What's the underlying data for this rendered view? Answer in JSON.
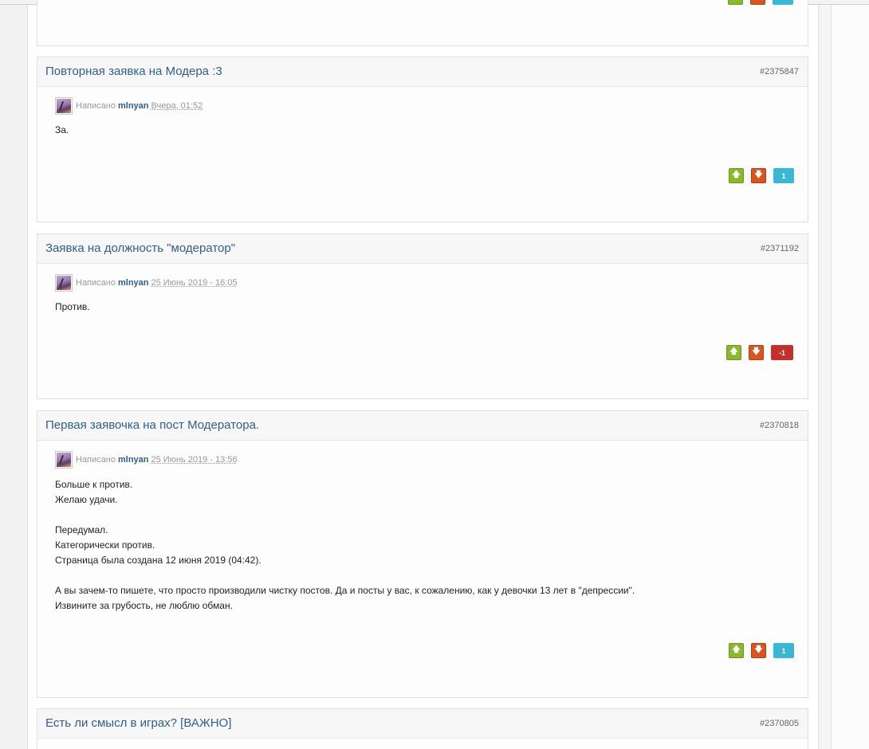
{
  "posts": [
    {
      "title": "Повторная заявка на Модера :3",
      "number": "#2375847",
      "written_label": "Написано",
      "author": "mlnyan",
      "date": "Вчера, 01:52",
      "lines": [
        "За."
      ],
      "reputation": "1",
      "rep_sign": "positive"
    },
    {
      "title": "Заявка на должность \"модератор\"",
      "number": "#2371192",
      "written_label": "Написано",
      "author": "mlnyan",
      "date": "25 Июнь 2019 - 16:05",
      "lines": [
        "Против."
      ],
      "reputation": "-1",
      "rep_sign": "negative"
    },
    {
      "title": "Первая заявочка на пост Модератора.",
      "number": "#2370818",
      "written_label": "Написано",
      "author": "mlnyan",
      "date": "25 Июнь 2019 - 13:56",
      "lines": [
        "Больше к против.",
        "Желаю удачи.",
        "",
        "Передумал.",
        "Категорически против.",
        "Страница была создана 12 июня 2019 (04:42).",
        "",
        "А вы зачем-то пишете, что просто производили чистку постов. Да и посты у вас, к сожалению, как у девочки 13 лет в \"депрессии\".",
        "Извините за грубость, не люблю обман."
      ],
      "reputation": "1",
      "rep_sign": "positive"
    },
    {
      "title": "Есть ли смысл в играх? [ВАЖНО]",
      "number": "#2370805"
    }
  ],
  "icons": {
    "vote_up": "arrow-up-icon",
    "vote_down": "arrow-down-icon"
  },
  "colors": {
    "title_link": "#2f5f8e",
    "vote_up": "#8cb82b",
    "vote_down": "#d9541e",
    "rep_positive": "#39b8d6",
    "rep_negative": "#c6302b"
  }
}
